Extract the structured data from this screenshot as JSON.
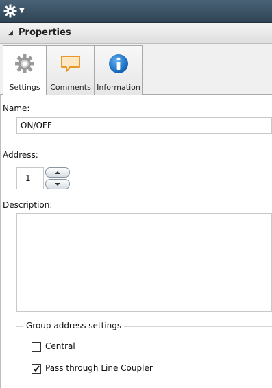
{
  "panel": {
    "section_title": "Properties",
    "tabs": [
      {
        "label": "Settings",
        "icon": "gear-icon",
        "active": true
      },
      {
        "label": "Comments",
        "icon": "speech-bubble-icon",
        "active": false
      },
      {
        "label": "Information",
        "icon": "info-icon",
        "active": false
      }
    ]
  },
  "settings": {
    "name_label": "Name:",
    "name_value": "ON/OFF",
    "address_label": "Address:",
    "address_value": "1",
    "description_label": "Description:",
    "description_value": "",
    "group_title": "Group address settings",
    "central_label": "Central",
    "central_checked": false,
    "pass_through_label": "Pass through Line Coupler",
    "pass_through_checked": true
  },
  "colors": {
    "titlebar": "#2f4556",
    "comments_icon": "#f0a030",
    "info_icon": "#1a6fc4"
  }
}
